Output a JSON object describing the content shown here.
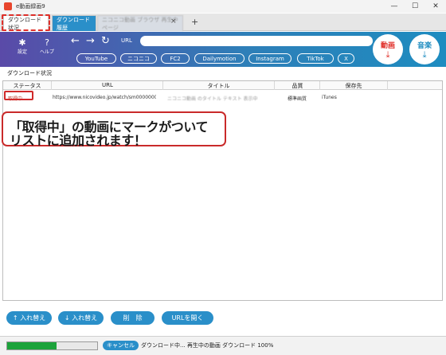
{
  "window": {
    "title": "e動画録画9",
    "minimize": "—",
    "maximize": "☐",
    "close": "✕"
  },
  "tabs": [
    {
      "label": "ダウンロード状況"
    },
    {
      "label": "ダウンロード履歴"
    },
    {
      "label": "ニコニコ動画 ブラウザ 再生中 ページ"
    }
  ],
  "tab_close": "×",
  "tab_add": "+",
  "toolbar": {
    "settings_label": "設定",
    "help_label": "ヘルプ",
    "back": "←",
    "forward": "→",
    "reload": "↻",
    "url_label": "URL",
    "url_value": "",
    "sites": [
      "YouTube",
      "ニコニコ",
      "FC2",
      "Dailymotion",
      "Instagram",
      "TikTok",
      "X"
    ],
    "video_button": "動画",
    "music_button": "音楽"
  },
  "section_title": "ダウンロード状況",
  "table": {
    "headers": [
      "ステータス",
      "URL",
      "タイトル",
      "品質",
      "保存先"
    ],
    "rows": [
      {
        "status": "取得中",
        "url": "https://www.nicovideo.jp/watch/sm000000000",
        "title": "ニコニコ動画 のタイトル テキスト 表示中",
        "quality": "標準画質",
        "destination": "iTunes"
      }
    ]
  },
  "callout": {
    "line1": "「取得中」の動画にマークがついて",
    "line2": "リストに追加されます！"
  },
  "buttons": {
    "move_up": "↑ 入れ替え",
    "move_down": "↓ 入れ替え",
    "delete": "削　除",
    "open_url": "URLを開く"
  },
  "statusbar": {
    "progress": 0.55,
    "cancel": "キャンセル",
    "status_text": "ダウンロード中... 再生中の動画 ダウンロード 100%"
  },
  "colors": {
    "accent": "#2a8fc9",
    "highlight": "#e0302a",
    "progress": "#1ca33b"
  }
}
